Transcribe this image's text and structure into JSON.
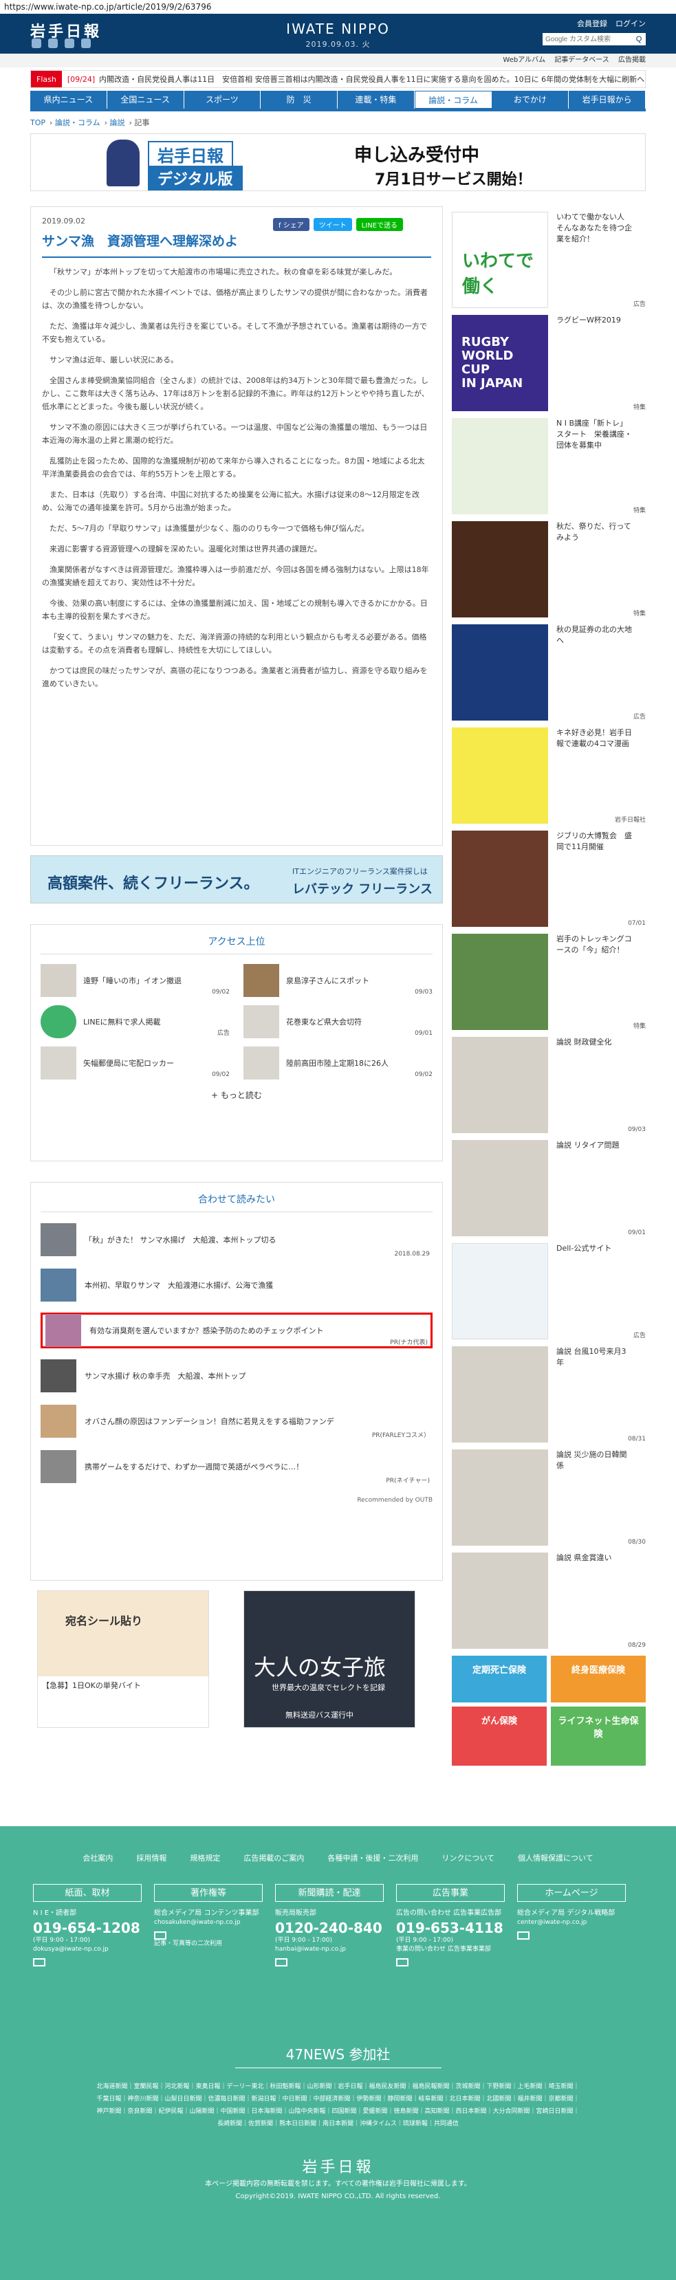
{
  "url": "https://www.iwate-np.co.jp/article/2019/9/2/63796",
  "header": {
    "logo_jp": "岩手日報",
    "logo_en": "IWATE NIPPO",
    "date": "2019.09.03. 火",
    "links": [
      "会員登録",
      "ログイン"
    ],
    "search_placeholder": "Google カスタム検索",
    "search_btn": "Q"
  },
  "subnav": [
    "Webアルバム",
    "記事データベース",
    "広告掲載"
  ],
  "flash": {
    "tag": "Flash",
    "date": "[09/24]",
    "text": "内閣改造・自民党役員人事は11日　安倍首相 安倍晋三首相は内閣改造・自民党役員人事を11日に実施する意向を固めた。10日に 6年間の党体制を大幅に刷新へ"
  },
  "nav": [
    "県内ニュース",
    "全国ニュース",
    "スポーツ",
    "防　災",
    "連載・特集",
    "論説・コラム",
    "おでかけ",
    "岩手日報から"
  ],
  "crumb": [
    "TOP",
    "論説・コラム",
    "論説",
    "記事"
  ],
  "top_banner": {
    "l1": "岩手日報",
    "l2": "デジタル版",
    "l3": "申し込み受付中",
    "l4": "7月1日サービス開始！"
  },
  "article": {
    "date": "2019.09.02",
    "title": "サンマ漁　資源管理へ理解深めよ",
    "share": [
      "f シェア",
      "ツイート",
      "LINEで送る"
    ],
    "paras": [
      "「秋サンマ」が本州トップを切って大船渡市の市場場に売立された。秋の食卓を彩る味覚が楽しみだ。",
      "その少し前に宮古で開かれた水揚イベントでは、価格が高止まりしたサンマの提供が間に合わなかった。消費者は、次の漁獲を待つしかない。",
      "ただ、漁獲は年々減少し、漁業者は先行きを案じている。そして不漁が予想されている。漁業者は期待の一方で不安も抱えている。",
      "サンマ漁は近年、厳しい状況にある。",
      "全国さんま棒受網漁業協同組合（全さんま）の統計では、2008年は約34万トンと30年間で最も豊漁だった。しかし、ここ数年は大きく落ち込み、17年は8万トンを割る記録的不漁に。昨年は約12万トンとやや持ち直したが、低水準にとどまった。今後も厳しい状況が続く。",
      "サンマ不漁の原因には大きく三つが挙げられている。一つは温度、中国など公海の漁獲量の増加、もう一つは日本近海の海水温の上昇と黒潮の蛇行だ。",
      "乱獲防止を図ったため、国際的な漁獲規制が初めて来年から導入されることになった。8カ国・地域による北太平洋漁業委員会の会合では、年約55万トンを上限とする。",
      "また、日本は（先取り）する台湾、中国に対抗するため操業を公海に拡大。水揚げは従来の8〜12月限定を改め、公海での通年操業を許可。5月から出漁が始まった。",
      "ただ、5〜7月の「早取りサンマ」は漁獲量が少なく、脂ののりも今一つで価格も伸び悩んだ。",
      "来週に影響する資源管理への理解を深めたい。温暖化対策は世界共通の課題だ。",
      "漁業関係者がなすべきは資源管理だ。漁獲枠導入は一歩前進だが、今回は各国を縛る強制力はない。上限は18年の漁獲実績を超えており、実効性は不十分だ。",
      "今後、効果の高い制度にするには、全体の漁獲量削減に加え、国・地域ごとの規制も導入できるかにかかる。日本も主導的役割を果たすべきだ。",
      "「安くて、うまい」サンマの魅力を、ただ、海洋資源の持続的な利用という観点からも考える必要がある。価格は変動する。その点を消費者も理解し、持続性を大切にしてほしい。",
      "かつては庶民の味だったサンマが、高嶺の花になりつつある。漁業者と消費者が協力し、資源を守る取り組みを進めていきたい。"
    ]
  },
  "ad_mid": {
    "t1": "高額案件、続くフリーランス。",
    "t2": "ITエンジニアのフリーランス案件探しは",
    "t3": "レバテック フリーランス"
  },
  "access": {
    "title": "アクセス上位",
    "items": [
      {
        "text": "遠野「睡いの市」イオン撤退",
        "date": "09/02"
      },
      {
        "text": "泉島淳子さんにスポット",
        "date": "09/03"
      },
      {
        "text": "LINEに無料で求人掲載",
        "date": "広告"
      },
      {
        "text": "花巻東など県大会切符",
        "date": "09/01"
      },
      {
        "text": "矢幅郵便局に宅配ロッカー",
        "date": "09/02"
      },
      {
        "text": "陸前高田市陸上定期18に26人",
        "date": "09/02"
      }
    ],
    "more": "もっと読む"
  },
  "together": {
    "title": "合わせて読みたい",
    "items": [
      {
        "text": "「秋」がきた！ サンマ水揚げ　大船渡、本州トップ切る",
        "date": "2018.08.29"
      },
      {
        "text": "本州初、早取りサンマ　大船渡港に水揚げ、公海で漁獲",
        "date": ""
      },
      {
        "text": "有効な消臭剤を選んでいますか？感染予防のためのチェックポイント",
        "date": "PR(ナカ代表)"
      },
      {
        "text": "サンマ水揚げ 秋の幸手売　大船渡、本州トップ",
        "date": ""
      },
      {
        "text": "オバさん顔の原因はファンデーション！自然に若見えをする福助ファンデ",
        "date": "PR(FARLEYコスメ）"
      },
      {
        "text": "携帯ゲームをするだけで、わずか一週間で英語がペラペラに…！",
        "date": "PR(ネイチャー)"
      }
    ],
    "recommend": "Recommended by OUTB"
  },
  "bad1": {
    "c1": "宛名シール貼り",
    "c2": "【急募】1日OKの単発バイト"
  },
  "bad2": {
    "c1": "大人の女子旅",
    "c2": "世界最大の温泉でセレクトを記録",
    "c3": "無料送迎バス運行中"
  },
  "side": [
    {
      "txt": "いわてで働かない人　そんなあなたを待つ企業を紹介！",
      "dt": "広告"
    },
    {
      "txt": "ラグビーW杯2019",
      "dt": "特集"
    },
    {
      "txt": "N I B講座「新トレ」スタート　栄養講座・団体を募集中",
      "dt": "特集"
    },
    {
      "txt": "秋だ、祭りだ、行ってみよう",
      "dt": "特集"
    },
    {
      "txt": "秋の見証券の北の大地へ",
      "dt": "広告"
    },
    {
      "txt": "キネ好き必見！岩手日報で連載の4コマ漫画",
      "dt": "岩手日報社"
    },
    {
      "txt": "ジブリの大博覧会　盛岡で11月開催",
      "dt": "07/01"
    },
    {
      "txt": "岩手のトレッキングコースの「今」紹介！",
      "dt": "特集"
    },
    {
      "txt": "論説 財政健全化",
      "dt": "09/03"
    },
    {
      "txt": "論説 リタイア問題",
      "dt": "09/01"
    },
    {
      "txt": "Dell-公式サイト",
      "dt": "広告"
    },
    {
      "txt": "論説 台風10号来月3年",
      "dt": "08/31"
    },
    {
      "txt": "論説 災少施の日韓関係",
      "dt": "08/30"
    },
    {
      "txt": "論説 県金賞違い",
      "dt": "08/29"
    }
  ],
  "side_ad": [
    "定期死亡保険",
    "終身医療保険",
    "がん保険",
    "ライフネット生命保険"
  ],
  "footer": {
    "links": [
      "会社案内",
      "採用情報",
      "規格規定",
      "広告掲載のご案内",
      "各種申請・後援・二次利用",
      "リンクについて",
      "個人情報保護について"
    ],
    "cols": [
      {
        "hd": "紙面、取材",
        "sub": "N I E・読者部",
        "tel": "019-654-1208",
        "sm": "(平日 9:00 - 17:00)",
        "mail": "dokusya@iwate-np.co.jp"
      },
      {
        "hd": "著作権等",
        "sub": "総合メディア局 コンテンツ事業部",
        "tel": "",
        "sm": "chosakuken@iwate-np.co.jp",
        "mail": "記事・写真等の二次利用"
      },
      {
        "hd": "新聞購読・配達",
        "sub": "販売局販売部",
        "tel": "0120-240-840",
        "sm": "(平日 9:00 - 17:00)",
        "mail": "hanbai@iwate-np.co.jp"
      },
      {
        "hd": "広告事業",
        "sub": "広告の問い合わせ 広告事業広告部",
        "tel": "019-653-4118",
        "sm": "(平日 9:00 - 17:00)",
        "mail": "事業の問い合わせ 広告事業事業部"
      },
      {
        "hd": "ホームページ",
        "sub": "総合メディア局 デジタル戦略部",
        "tel": "",
        "sm": "center@iwate-np.co.jp",
        "mail": ""
      }
    ],
    "title47": "47NEWS 参加社",
    "papers": "北海道新聞｜室蘭民報｜河北新報｜東奥日報｜デーリー東北｜秋田魁新報｜山形新聞｜岩手日報｜福島民友新聞｜福島民報新聞｜茨城新聞｜下野新聞｜上毛新聞｜埼玉新聞｜千葉日報｜神奈川新聞｜山梨日日新聞｜信濃毎日新聞｜新潟日報｜中日新聞｜中部経済新聞｜伊勢新聞｜静岡新聞｜岐阜新聞｜北日本新聞｜北國新聞｜福井新聞｜京都新聞｜神戸新聞｜奈良新聞｜紀伊民報｜山陽新聞｜中国新聞｜日本海新聞｜山陰中央新報｜四国新聞｜愛媛新聞｜徳島新聞｜高知新聞｜西日本新聞｜大分合同新聞｜宮崎日日新聞｜長崎新聞｜佐賀新聞｜熊本日日新聞｜南日本新聞｜沖縄タイムス｜琉球新報｜共同通信",
    "logo": "岩手日報",
    "copy1": "本ページ掲載内容の無断転載を禁じます。すべての著作権は岩手日報社に帰属します。",
    "copy2": "Copyright©2019. IWATE NIPPO CO.,LTD. All rights reserved."
  }
}
